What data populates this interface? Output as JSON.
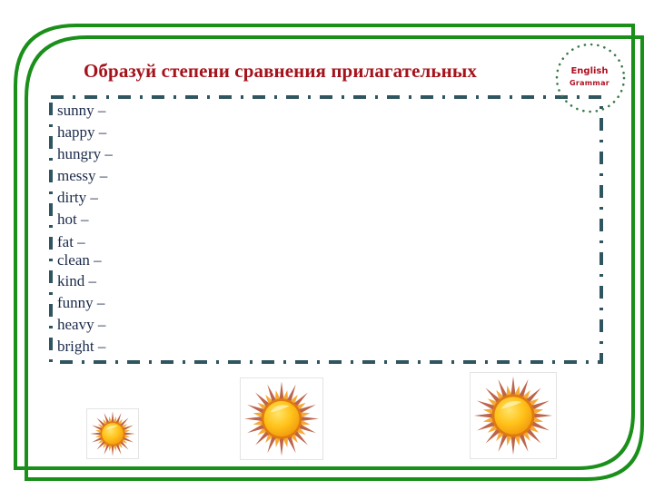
{
  "slide": {
    "title": "Образуй степени сравнения прилагательных",
    "badge": {
      "line1": "English",
      "line2": "Grammar"
    },
    "words": [
      "sunny –",
      "happy –",
      "hungry –",
      "messy –",
      "dirty –",
      "hot –",
      "fat –",
      "clean –",
      "kind –",
      "funny –",
      "heavy –",
      "bright –"
    ],
    "images": [
      {
        "icon": "sun-icon",
        "label": "small sun"
      },
      {
        "icon": "sun-icon",
        "label": "medium sun"
      },
      {
        "icon": "sun-icon",
        "label": "large sun"
      }
    ]
  },
  "colors": {
    "frame": "#1a8f1a",
    "title": "#a5121b",
    "dash_border": "#2f5560",
    "badge_dots": "#3a7a4a",
    "word_text": "#1b2a4a"
  }
}
